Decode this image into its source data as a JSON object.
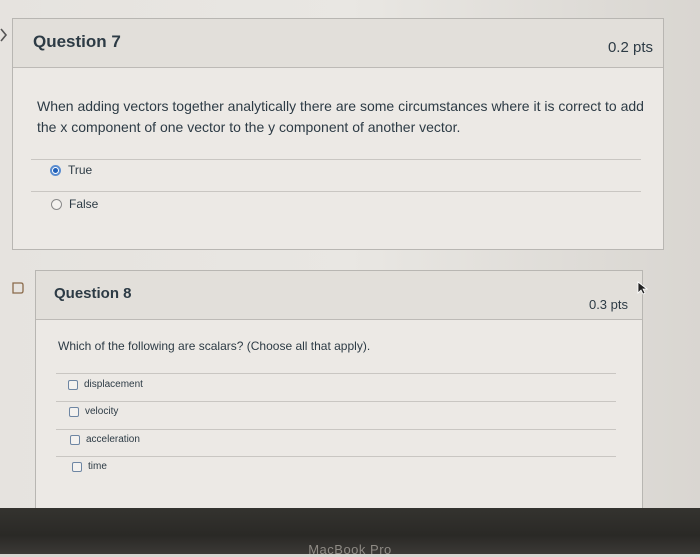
{
  "question7": {
    "title": "Question 7",
    "points": "0.2 pts",
    "text": "When adding vectors together analytically there are some circumstances where it is correct to add the x component of one vector to the y component of another vector.",
    "answers": [
      {
        "label": "True",
        "selected": true
      },
      {
        "label": "False",
        "selected": false
      }
    ]
  },
  "question8": {
    "title": "Question 8",
    "points": "0.3 pts",
    "text": "Which of the following are scalars? (Choose all that apply).",
    "answers": [
      {
        "label": "displacement",
        "checked": false
      },
      {
        "label": "velocity",
        "checked": false
      },
      {
        "label": "acceleration",
        "checked": false
      },
      {
        "label": "time",
        "checked": false
      }
    ]
  },
  "device": {
    "label": "MacBook Pro"
  },
  "icons": {
    "nav": "chevron-right-icon",
    "flag": "flag-question-icon",
    "cursor": "mouse-pointer-icon"
  },
  "colors": {
    "radio_selected": "#1f5fb8",
    "text": "#2d3b45"
  }
}
